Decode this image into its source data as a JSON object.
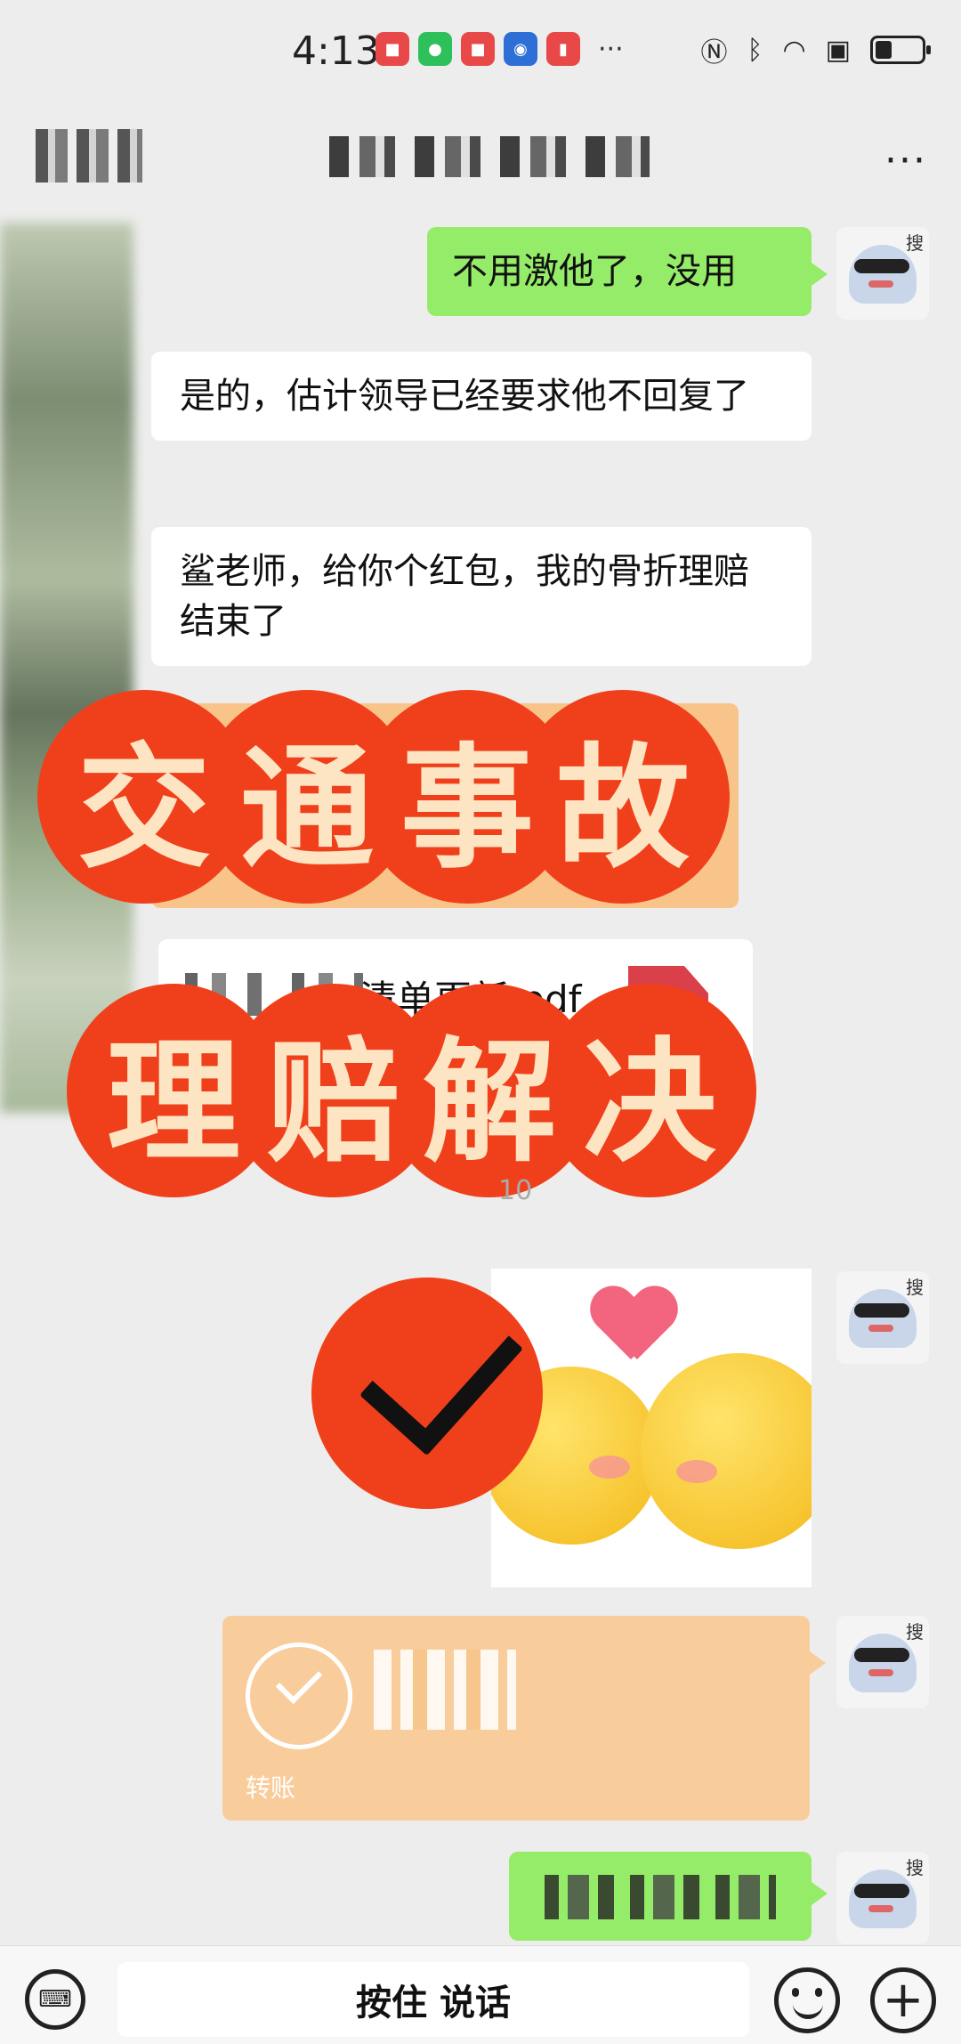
{
  "status_bar": {
    "time": "4:13",
    "app_icons": [
      {
        "name": "huawei-appgallery-icon",
        "color": "#e84848",
        "glyph": "■"
      },
      {
        "name": "wechat-icon",
        "color": "#2ec05a",
        "glyph": "●"
      },
      {
        "name": "huawei-store-icon",
        "color": "#e84848",
        "glyph": "■"
      },
      {
        "name": "bulb-icon",
        "color": "#2d6fd6",
        "glyph": "◉"
      },
      {
        "name": "book-icon",
        "color": "#e84848",
        "glyph": "▮"
      }
    ],
    "more": "···",
    "system_icons": [
      "nfc-icon",
      "bluetooth-icon",
      "wifi-icon",
      "alert-icon",
      "battery-icon"
    ]
  },
  "nav": {
    "more": "···"
  },
  "messages": [
    {
      "side": "right",
      "type": "text",
      "text": "不用激他了，没用"
    },
    {
      "side": "left",
      "type": "text",
      "text": "是的，估计领导已经要求他不回复了"
    },
    {
      "side": "left",
      "type": "text",
      "text": "鲨老师，给你个红包，我的骨折理赔结束了"
    },
    {
      "side": "left",
      "type": "file",
      "filename": "清单更新.pdf"
    },
    {
      "side": "right",
      "type": "transfer",
      "label": "转账"
    }
  ],
  "overlay": {
    "line1": [
      "交",
      "通",
      "事",
      "故"
    ],
    "line2": [
      "理",
      "赔",
      "解",
      "决"
    ]
  },
  "bottom_bar": {
    "voice_label": "按住 说话"
  },
  "colors": {
    "background": "#ededed",
    "sent_bubble": "#95ec69",
    "received_bubble": "#ffffff",
    "transfer_card": "#f9cd9b",
    "badge": "#f0401b",
    "badge_text": "#fde5c3"
  }
}
